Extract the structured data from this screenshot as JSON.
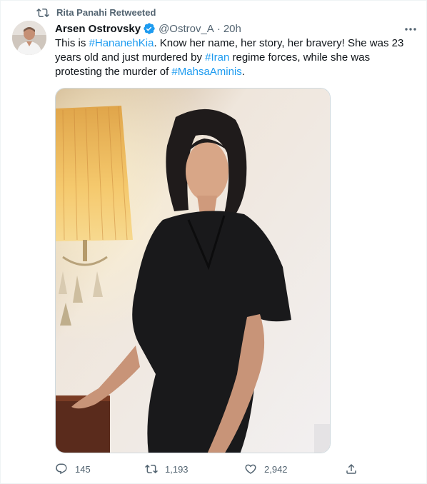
{
  "retweet_context": {
    "text": "Rita Panahi Retweeted",
    "icon": "retweet-icon"
  },
  "author": {
    "name": "Arsen Ostrovsky",
    "handle": "@Ostrov_A",
    "separator": "·",
    "time": "20h",
    "verified": true
  },
  "tweet": {
    "segments": [
      {
        "text": "This is ",
        "type": "text"
      },
      {
        "text": "#HananehKia",
        "type": "hashtag"
      },
      {
        "text": ". Know her name, her story, her bravery! She was 23 years old and just murdered by ",
        "type": "text"
      },
      {
        "text": "#Iran",
        "type": "hashtag"
      },
      {
        "text": " regime forces, while she was protesting the murder of ",
        "type": "text"
      },
      {
        "text": "#MahsaAminis",
        "type": "hashtag"
      },
      {
        "text": ".",
        "type": "text"
      }
    ]
  },
  "actions": {
    "replies": "145",
    "retweets": "1,193",
    "likes": "2,942"
  },
  "colors": {
    "link": "#1d9bf0",
    "secondary_text": "#536471",
    "primary_text": "#0f1419",
    "verified": "#1d9bf0"
  }
}
